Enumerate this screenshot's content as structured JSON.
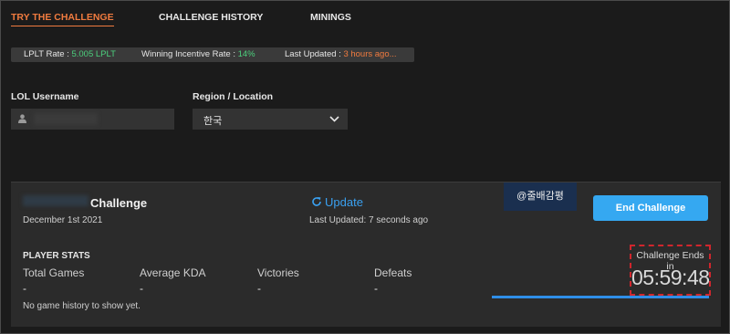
{
  "tabs": [
    {
      "label": "TRY THE CHALLENGE",
      "active": true
    },
    {
      "label": "CHALLENGE HISTORY",
      "active": false
    },
    {
      "label": "MININGS",
      "active": false
    }
  ],
  "rates": {
    "lplt_label": "LPLT Rate : ",
    "lplt_value": "5.005 LPLT",
    "incentive_label": "Winning Incentive Rate : ",
    "incentive_value": "14%",
    "updated_label": "Last Updated : ",
    "updated_value": "3 hours ago..."
  },
  "form": {
    "username_label": "LOL Username",
    "username_value": "",
    "region_label": "Region / Location",
    "region_value": "한국"
  },
  "challenge": {
    "title": "Challenge",
    "date": "December 1st 2021",
    "update_label": "Update",
    "last_updated": "Last Updated: 7 seconds ago",
    "watermark": "@줄배감평",
    "end_button": "End Challenge",
    "timer_caption": "Challenge Ends in",
    "timer_value": "05:59:48",
    "progress_fraction": 1.0
  },
  "stats": {
    "title": "PLAYER STATS",
    "columns": [
      {
        "label": "Total Games",
        "value": "-"
      },
      {
        "label": "Average KDA",
        "value": "-"
      },
      {
        "label": "Victories",
        "value": "-"
      },
      {
        "label": "Defeats",
        "value": "-"
      }
    ],
    "empty_message": "No game history to show yet."
  },
  "colors": {
    "accent_orange": "#f07b3f",
    "accent_blue": "#35a8f1",
    "positive_green": "#4cd07d",
    "highlight_red": "#d0262d"
  }
}
